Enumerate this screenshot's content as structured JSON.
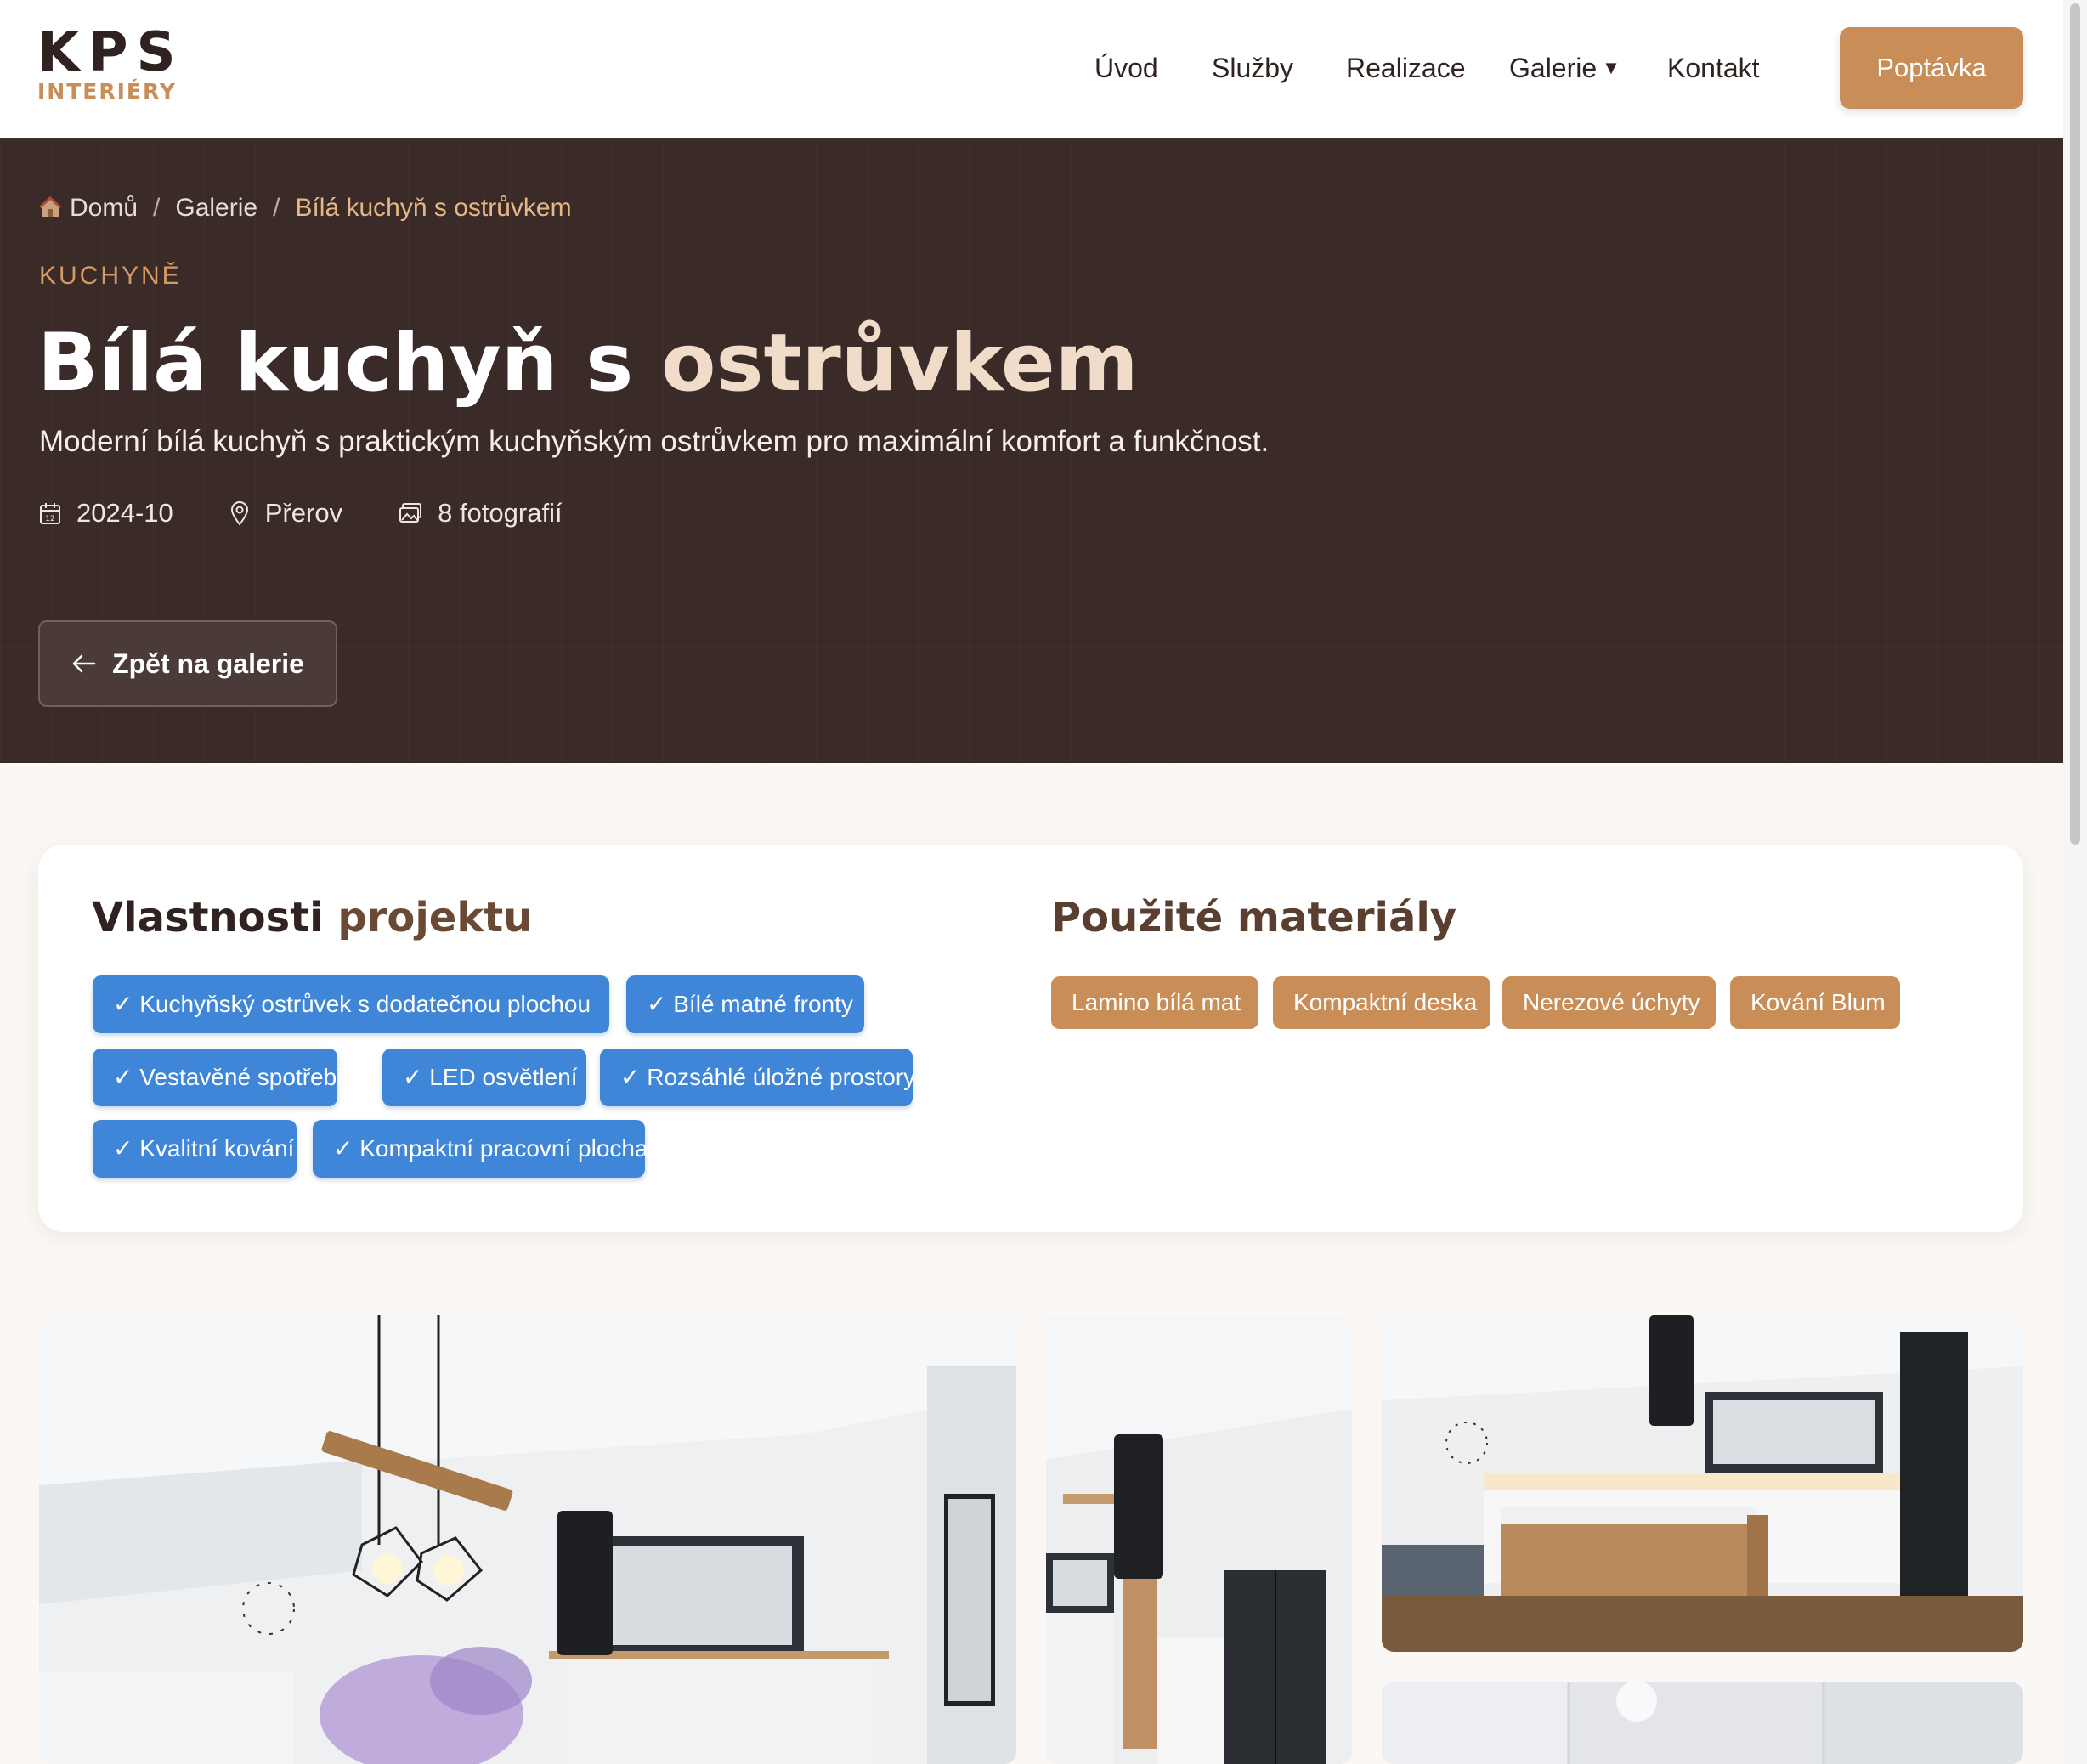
{
  "header": {
    "logo": {
      "main": "KPS",
      "sub": "INTERIÉRY"
    },
    "nav": [
      {
        "label": "Úvod"
      },
      {
        "label": "Služby"
      },
      {
        "label": "Realizace"
      },
      {
        "label": "Galerie",
        "has_dropdown": true,
        "caret": "▼"
      },
      {
        "label": "Kontakt"
      }
    ],
    "cta_label": "Poptávka"
  },
  "hero": {
    "breadcrumb": {
      "home": "Domů",
      "separator": "/",
      "section": "Galerie",
      "current": "Bílá kuchyň s ostrůvkem"
    },
    "category": "KUCHYNĚ",
    "title_main": "Bílá kuchyň s ",
    "title_accent": "ostrůvkem",
    "subtitle": "Moderní bílá kuchyň s praktickým kuchyňským ostrůvkem pro maximální komfort a funkčnost.",
    "meta": {
      "date": "2024-10",
      "location": "Přerov",
      "photos": "8 fotografií"
    },
    "back_label": "Zpět na galerie"
  },
  "properties": {
    "title_main": "Vlastnosti ",
    "title_accent": "projektu",
    "features": [
      "✓ Kuchyňský ostrůvek s dodatečnou plochou",
      "✓ Bílé matné fronty",
      "✓ Vestavěné spotřebiče",
      "✓ LED osvětlení",
      "✓ Rozsáhlé úložné prostory",
      "✓ Kvalitní kování",
      "✓ Kompaktní pracovní plocha"
    ]
  },
  "materials": {
    "title": "Použité materiály",
    "items": [
      "Lamino bílá mat",
      "Kompaktní deska",
      "Nerezové úchyty",
      "Kování Blum"
    ]
  },
  "colors": {
    "accent": "#c98d57",
    "hero_bg": "#3a2b29",
    "feature_chip": "#3f86d8",
    "page_bg": "#faf7f4"
  },
  "icons": [
    "home-icon",
    "calendar-icon",
    "location-pin-icon",
    "photos-icon",
    "arrow-left-icon",
    "caret-down-icon"
  ]
}
